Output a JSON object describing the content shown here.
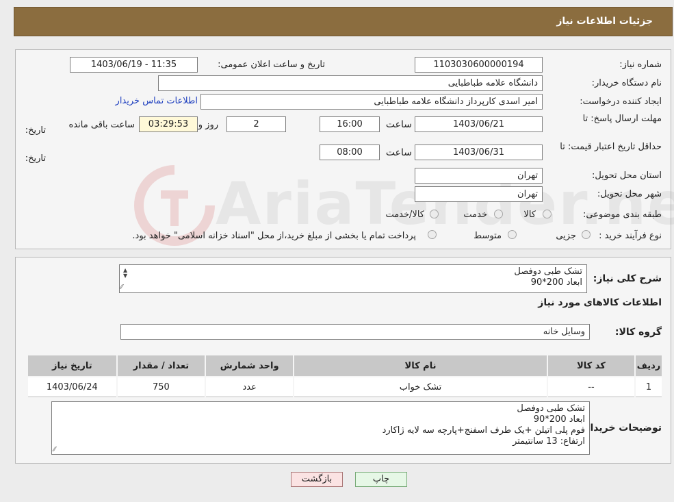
{
  "header": {
    "title": "جزئیات اطلاعات نیاز"
  },
  "form": {
    "need_number": {
      "label": "شماره نیاز:",
      "value": "1103030600000194"
    },
    "announce": {
      "label": "تاریخ و ساعت اعلان عمومی:",
      "value": "1403/06/19 - 11:35"
    },
    "buyer_org": {
      "label": "نام دستگاه خریدار:",
      "value": "دانشگاه علامه طباطبایی"
    },
    "creator": {
      "label": "ایجاد کننده درخواست:",
      "value": "امیر اسدی کارپرداز دانشگاه علامه طباطبایی",
      "contact_link": "اطلاعات تماس خریدار"
    },
    "deadline": {
      "label": "مهلت ارسال پاسخ: تا تاریخ:",
      "date": "1403/06/21",
      "time_label": "ساعت",
      "time": "16:00",
      "days": "2",
      "days_label": "روز و",
      "remaining": "03:29:53",
      "remaining_label": "ساعت باقی مانده"
    },
    "validity": {
      "label": "حداقل تاریخ اعتبار قیمت: تا تاریخ:",
      "date": "1403/06/31",
      "time_label": "ساعت",
      "time": "08:00"
    },
    "province": {
      "label": "استان محل تحویل:",
      "value": "تهران"
    },
    "city": {
      "label": "شهر محل تحویل:",
      "value": "تهران"
    },
    "category": {
      "label": "طبقه بندی موضوعی:",
      "options": [
        "کالا",
        "خدمت",
        "کالا/خدمت"
      ]
    },
    "process": {
      "label": "نوع فرآیند خرید :",
      "options": [
        "جزیی",
        "متوسط"
      ],
      "note": "پرداخت تمام یا بخشی از مبلغ خرید،از محل \"اسناد خزانه اسلامی\" خواهد بود."
    }
  },
  "details": {
    "summary_label": "شرح کلی نیاز:",
    "summary_lines": [
      "تشک طبی دوفصل",
      "ابعاد 200*90"
    ],
    "goods_info_title": "اطلاعات کالاهای مورد نیاز",
    "group_label": "گروه کالا:",
    "group_value": "وسایل خانه",
    "table": {
      "headers": [
        "ردیف",
        "کد کالا",
        "نام کالا",
        "واحد شمارش",
        "تعداد / مقدار",
        "تاریخ نیاز"
      ],
      "rows": [
        [
          "1",
          "--",
          "تشک خواب",
          "عدد",
          "750",
          "1403/06/24"
        ]
      ]
    },
    "buyer_notes_label": "توضیحات خریدار:",
    "buyer_notes_lines": [
      "تشک طبی دوفصل",
      "ابعاد 200*90",
      "فوم پلی اتیلن +یک طرف اسفنج+پارچه سه لایه ژاکارد",
      "ارتفاع: 13 سانتیمتر"
    ]
  },
  "buttons": {
    "print": "چاپ",
    "back": "بازگشت"
  },
  "watermark": {
    "text": "AriaTender.neT"
  }
}
